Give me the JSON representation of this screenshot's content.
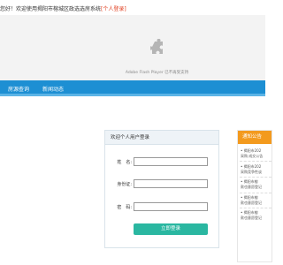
{
  "header": {
    "welcome_text": "您好！欢迎使用揭阳市榕城区政选选房系统",
    "login_link": "[个人登录]"
  },
  "flash": {
    "icon": "puzzle-plugin-icon",
    "message": "Adobe Flash Player 已不再受支持"
  },
  "nav": {
    "items": [
      "房源查询",
      "新闻动态"
    ]
  },
  "login": {
    "title": "欢迎个人用户登录",
    "name_label": "姓　名:",
    "id_label": "身份证:",
    "password_label": "密　码:",
    "name_value": "",
    "id_value": "",
    "password_value": "",
    "submit_label": "立即登录"
  },
  "notice": {
    "title": "通知公告",
    "items": [
      {
        "line1": "揭阳市202",
        "line2": "采购 成交公告"
      },
      {
        "line1": "揭阳市202",
        "line2": "采购竞争性谈"
      },
      {
        "line1": "揭阳市榕",
        "line2": "款也意愿登记"
      },
      {
        "line1": "揭阳市榕",
        "line2": "款也意愿登记"
      },
      {
        "line1": "揭阳市榕",
        "line2": "款也意愿登记"
      }
    ]
  },
  "colors": {
    "nav_bg": "#1d8fd3",
    "login_button": "#2ab7a1",
    "notice_head": "#f39a1e",
    "login_link": "#e03c1c"
  }
}
